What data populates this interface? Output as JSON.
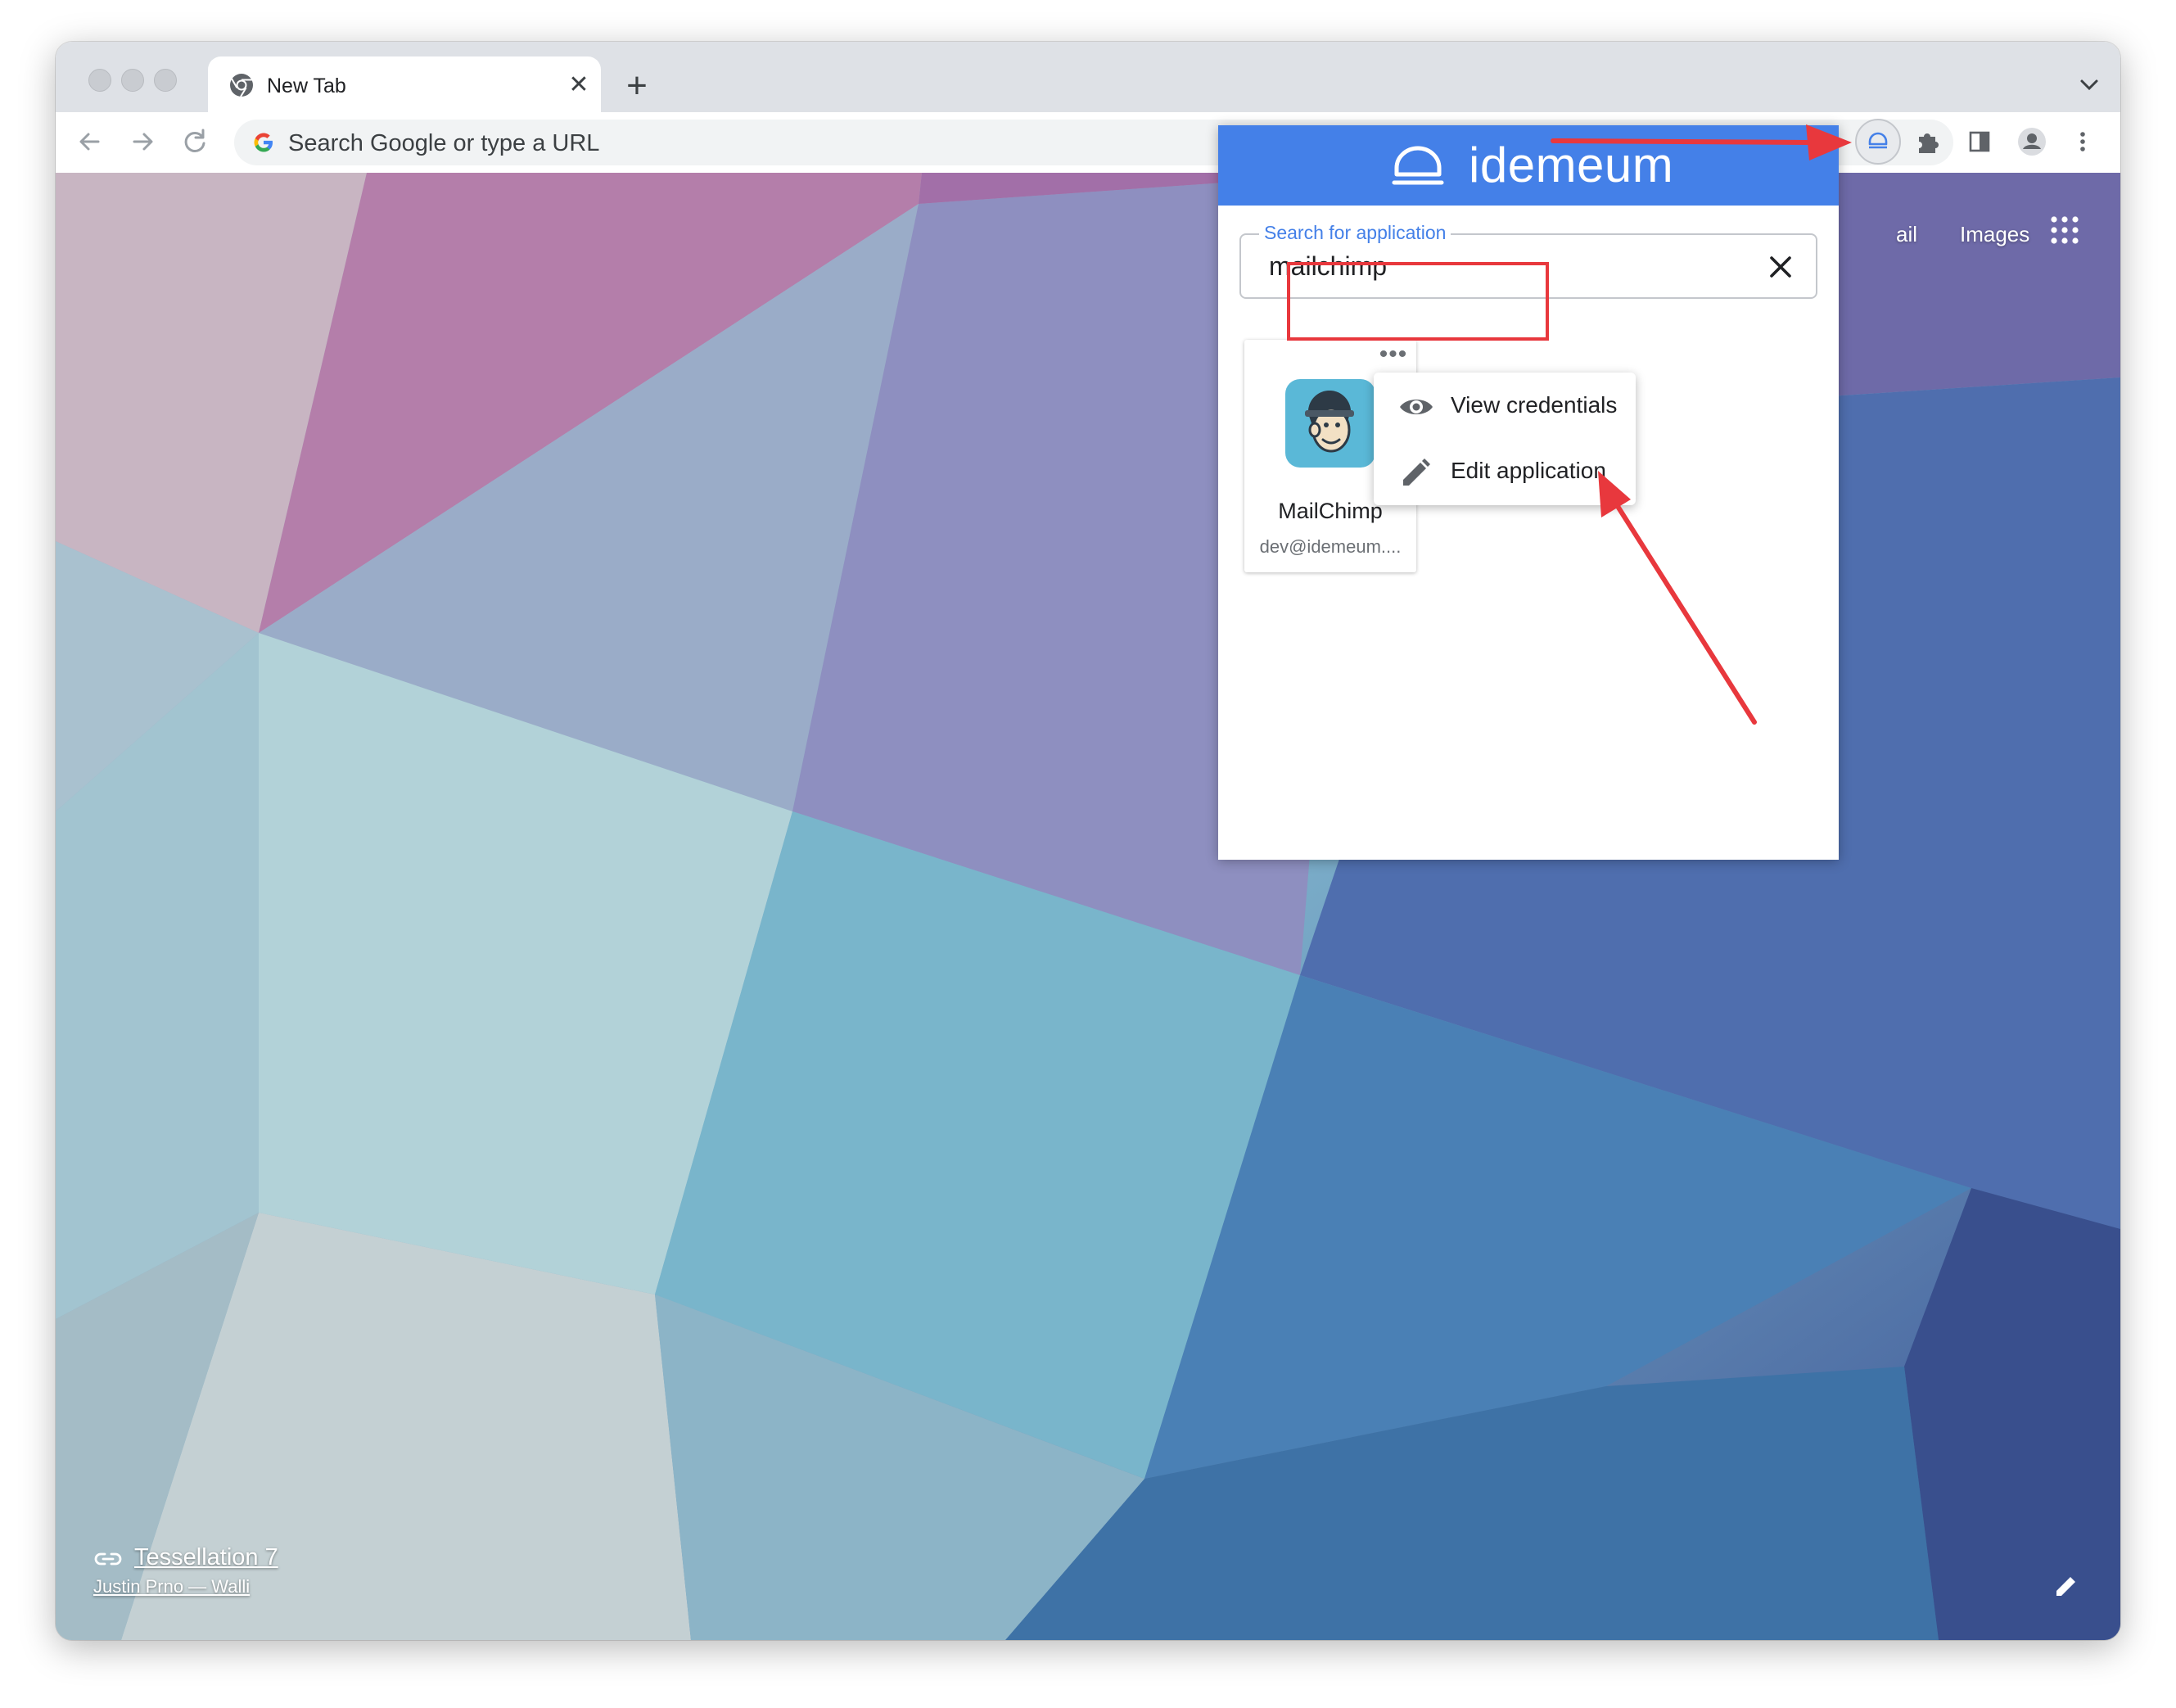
{
  "browser": {
    "tab_title": "New Tab",
    "new_tab_symbol": "+",
    "close_symbol": "✕",
    "omnibox_placeholder": "Search Google or type a URL"
  },
  "ntp": {
    "links": [
      "ail",
      "Images"
    ],
    "background_title": "Tessellation 7",
    "background_credit": "Justin Prno — Walli"
  },
  "extension_popup": {
    "brand": "idemeum",
    "header_color": "#4480e8",
    "search": {
      "label": "Search for application",
      "value": "mailchimp"
    },
    "card": {
      "more_symbol": "•••",
      "app_name": "MailChimp",
      "account": "dev@idemeum...."
    },
    "menu": [
      {
        "label": "View credentials",
        "icon": "eye-icon"
      },
      {
        "label": "Edit application",
        "icon": "pencil-icon"
      }
    ]
  },
  "annotation_color": "#e8383d"
}
